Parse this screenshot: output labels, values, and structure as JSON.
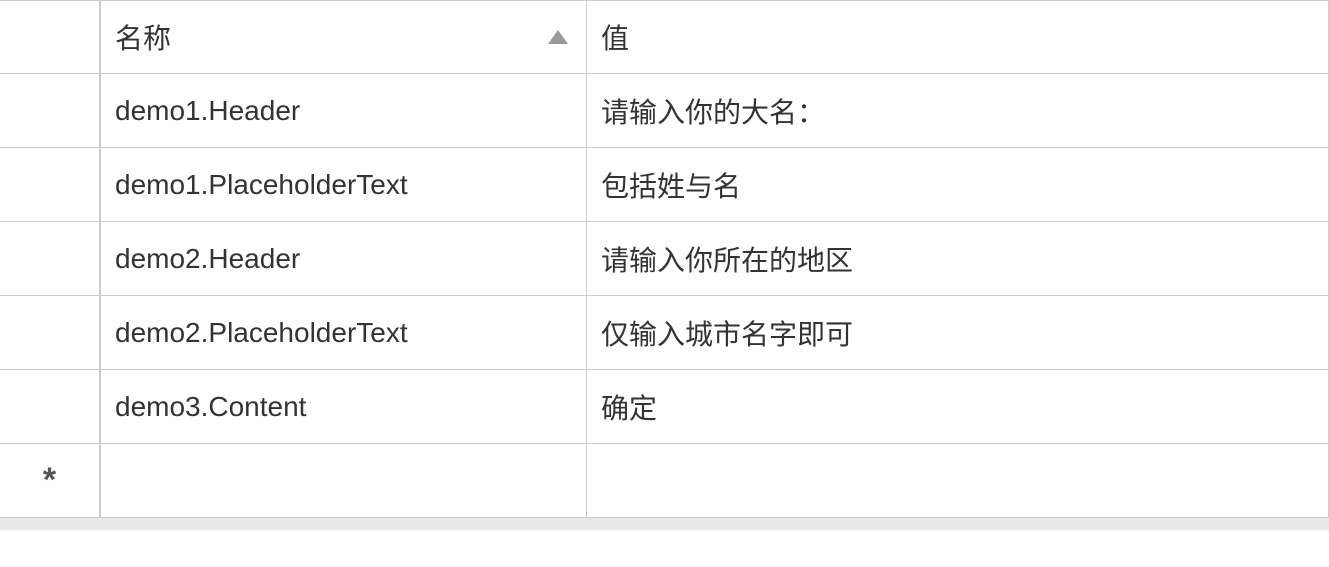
{
  "header": {
    "name_label": "名称",
    "value_label": "值"
  },
  "rows": [
    {
      "name": "demo1.Header",
      "value": "请输入你的大名："
    },
    {
      "name": "demo1.PlaceholderText",
      "value": "包括姓与名"
    },
    {
      "name": "demo2.Header",
      "value": "请输入你所在的地区"
    },
    {
      "name": "demo2.PlaceholderText",
      "value": "仅输入城市名字即可"
    },
    {
      "name": "demo3.Content",
      "value": "确定"
    }
  ],
  "new_row_marker": "*"
}
